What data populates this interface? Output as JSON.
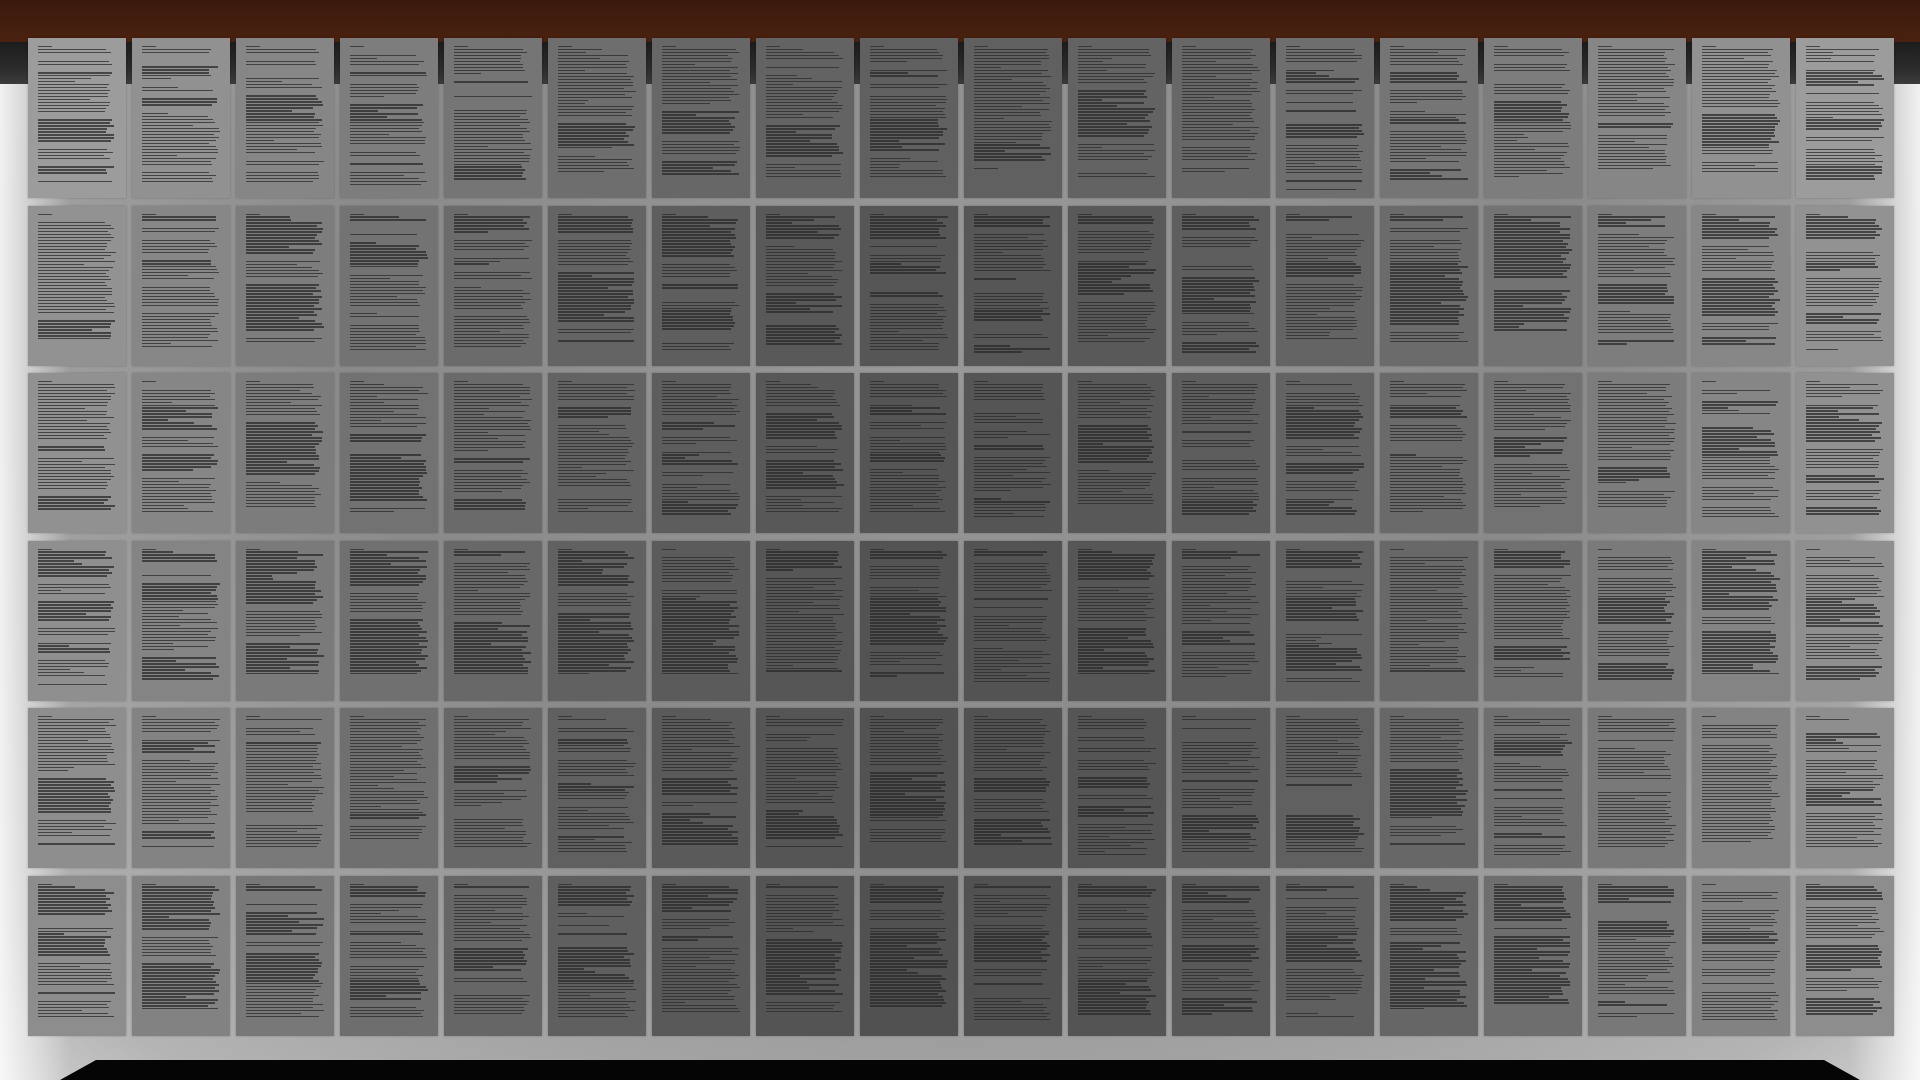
{
  "scene": {
    "description_kind": "wall of printed document pages arranged in a grid",
    "rows": 6,
    "columns": 18
  },
  "colors": {
    "top_band": "#3e1b0c",
    "rail": "#262626",
    "page_center": "#5a5a5a",
    "page_edge": "#9e9e9e",
    "text_lines": "#2a2a2a",
    "floor_strip": "#050505"
  },
  "pages": {
    "text_legible": false
  }
}
